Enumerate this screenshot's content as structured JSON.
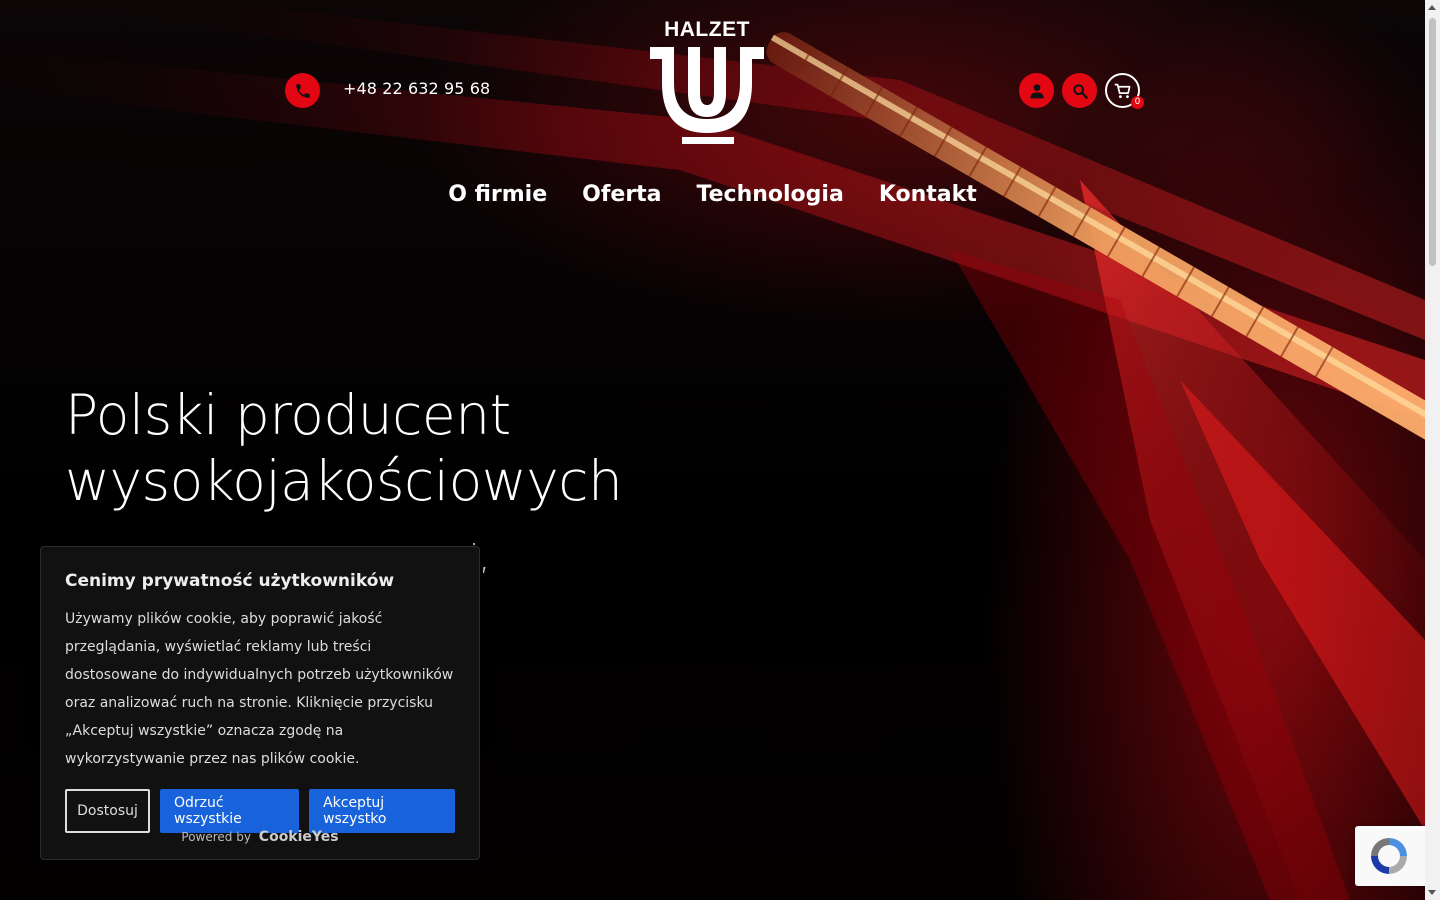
{
  "header": {
    "phone": "+48 22 632 95 68",
    "logo_text": "HALZET",
    "cart_count": "0"
  },
  "nav": {
    "items": [
      "O firmie",
      "Oferta",
      "Technologia",
      "Kontakt"
    ]
  },
  "hero": {
    "title_line1": "Polski producent",
    "title_line2": "wysokojakościowych",
    "subtitle_partial": "ni,"
  },
  "cookie_banner": {
    "title": "Cenimy prywatność użytkowników",
    "text": "Używamy plików cookie, aby poprawić jakość przeglądania, wyświetlać reklamy lub treści dostosowane do indywidualnych potrzeb użytkowników oraz analizować ruch na stronie. Kliknięcie przycisku „Akceptuj wszystkie” oznacza zgodę na wykorzystywanie przez nas plików cookie.",
    "customize_label": "Dostosuj",
    "reject_label": "Odrzuć wszystkie",
    "accept_label": "Akceptuj wszystko",
    "powered_by": "Powered by",
    "brand": "CookieYes"
  },
  "colors": {
    "accent": "#e30613",
    "cookie_button_blue": "#1863dc"
  },
  "icons": {
    "phone": "phone-icon",
    "account": "user-icon",
    "search": "search-icon",
    "cart": "cart-icon",
    "recaptcha": "recaptcha-icon"
  }
}
